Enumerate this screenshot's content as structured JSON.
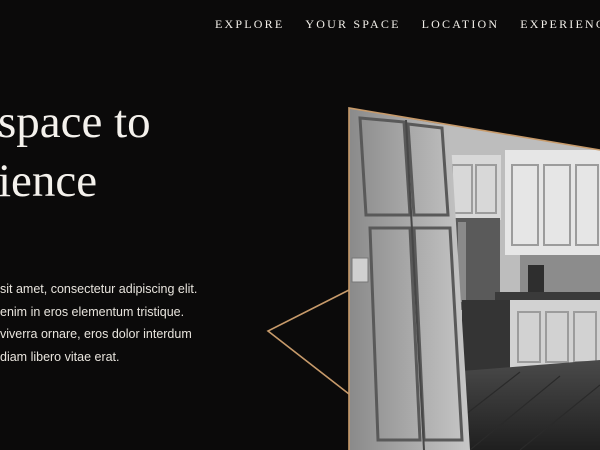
{
  "nav": {
    "items": [
      {
        "label": "EXPLORE"
      },
      {
        "label": "YOUR SPACE"
      },
      {
        "label": "LOCATION"
      },
      {
        "label": "EXPERIENCE"
      }
    ]
  },
  "hero": {
    "headline_lines": [
      "space to",
      "ience"
    ],
    "body_lines": [
      "sit amet, consectetur adipiscing elit.",
      "enim in eros elementum tristique.",
      " viverra ornare, eros dolor interdum",
      "diam libero vitae erat."
    ]
  },
  "image": {
    "icon": "kitchen-photo",
    "tone": "grayscale"
  },
  "colors": {
    "background": "#0b0a0a",
    "accent": "#c79a6a",
    "text": "#f2efe9"
  }
}
